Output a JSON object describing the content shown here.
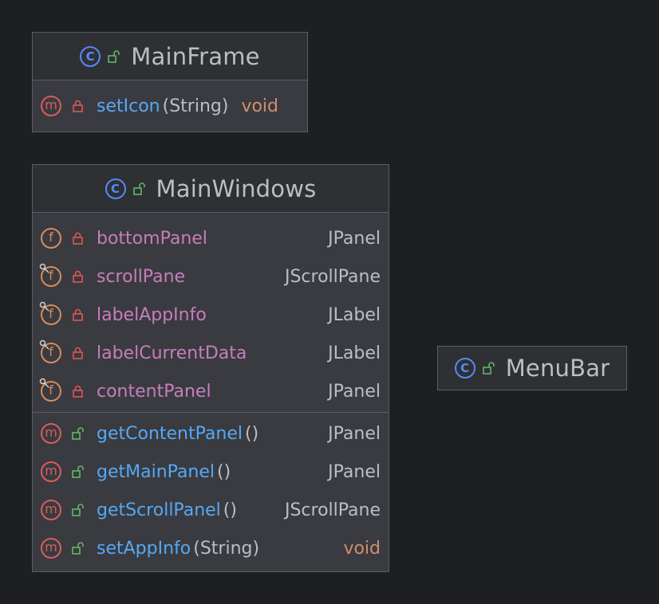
{
  "colors": {
    "background": "#1e1f22",
    "class_body": "#393b40",
    "class_header": "#2f3034",
    "border": "#5a5d63",
    "class_badge": "#548af7",
    "method_badge": "#db5c5c",
    "field_badge": "#d98a5b",
    "private_lock": "#e05555",
    "public_lock": "#5fb865",
    "method_name": "#56a8f5",
    "field_name": "#c77dbb",
    "void_type": "#cf8e6d",
    "text": "#bcbec4"
  },
  "icons": {
    "class_badge_glyph": "C",
    "method_badge_glyph": "m",
    "field_badge_glyph": "f",
    "private": "lock-closed-icon",
    "public": "lock-open-icon",
    "final_field": "pin-icon"
  },
  "classes": {
    "mainframe": {
      "name": "MainFrame",
      "methods": [
        {
          "name": "setIcon",
          "params": "(String)",
          "type": "void"
        }
      ]
    },
    "mainwindows": {
      "name": "MainWindows",
      "fields": [
        {
          "name": "bottomPanel",
          "type": "JPanel"
        },
        {
          "name": "scrollPane",
          "type": "JScrollPane"
        },
        {
          "name": "labelAppInfo",
          "type": "JLabel"
        },
        {
          "name": "labelCurrentData",
          "type": "JLabel"
        },
        {
          "name": "contentPanel",
          "type": "JPanel"
        }
      ],
      "methods": [
        {
          "name": "getContentPanel",
          "params": "()",
          "type": "JPanel"
        },
        {
          "name": "getMainPanel",
          "params": "()",
          "type": "JPanel"
        },
        {
          "name": "getScrollPanel",
          "params": "()",
          "type": "JScrollPane"
        },
        {
          "name": "setAppInfo",
          "params": "(String)",
          "type": "void"
        }
      ]
    },
    "menubar": {
      "name": "MenuBar"
    }
  }
}
